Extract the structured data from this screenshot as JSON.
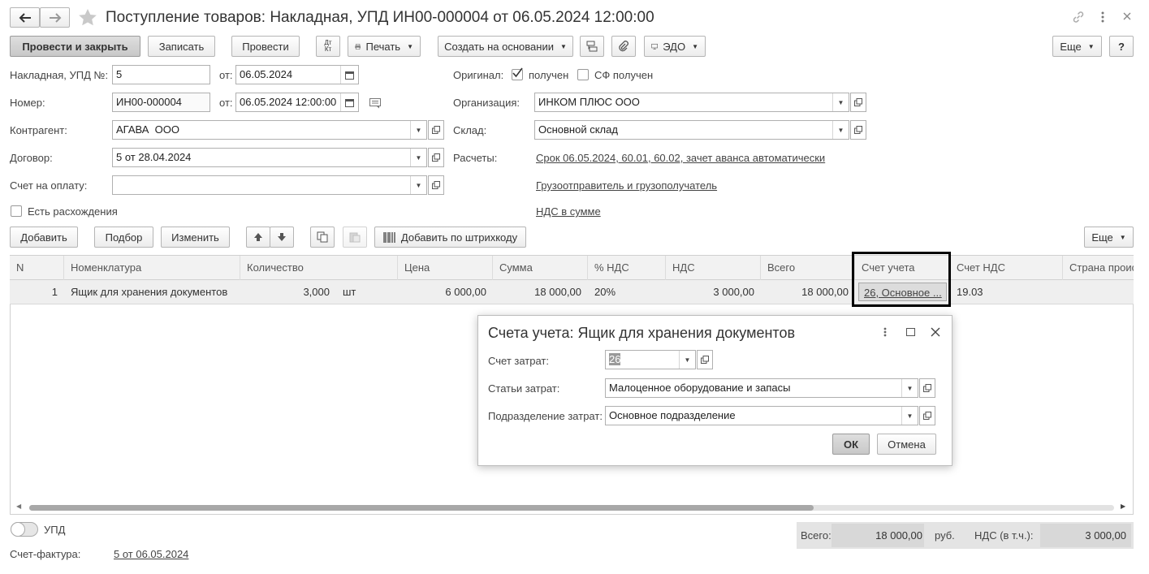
{
  "window": {
    "title": "Поступление товаров: Накладная, УПД ИН00-000004 от 06.05.2024 12:00:00"
  },
  "toolbar": {
    "post_close": "Провести и закрыть",
    "save": "Записать",
    "post": "Провести",
    "dt_kt": "Дт Кт",
    "print": "Печать",
    "create_based": "Создать на основании",
    "edo": "ЭДО",
    "more": "Еще",
    "help": "?"
  },
  "form": {
    "invoice_label": "Накладная, УПД №:",
    "invoice_value": "5",
    "from_label": "от:",
    "invoice_date": "06.05.2024",
    "number_label": "Номер:",
    "number_value": "ИН00-000004",
    "number_date": "06.05.2024 12:00:00",
    "contractor_label": "Контрагент:",
    "contractor_value": "АГАВА  ООО",
    "contract_label": "Договор:",
    "contract_value": "5 от 28.04.2024",
    "payment_label": "Счет на оплату:",
    "payment_value": "",
    "discrepancy_label": "Есть расхождения",
    "original_label": "Оригинал:",
    "received_label": "получен",
    "sf_received_label": "СФ получен",
    "org_label": "Организация:",
    "org_value": "ИНКОМ ПЛЮС ООО",
    "warehouse_label": "Склад:",
    "warehouse_value": "Основной склад",
    "settlements_label": "Расчеты:",
    "settlements_link": "Срок 06.05.2024, 60.01, 60.02, зачет аванса автоматически",
    "shipper_link": "Грузоотправитель и грузополучатель",
    "vat_link": "НДС в сумме"
  },
  "table_toolbar": {
    "add": "Добавить",
    "pick": "Подбор",
    "change": "Изменить",
    "barcode": "Добавить по штрихкоду",
    "more": "Еще"
  },
  "table": {
    "columns": [
      "N",
      "Номенклатура",
      "Количество",
      "Цена",
      "Сумма",
      "% НДС",
      "НДС",
      "Всего",
      "Счет учета",
      "Счет НДС",
      "Страна проис"
    ],
    "rows": [
      {
        "n": "1",
        "item": "Ящик для хранения документов",
        "qty": "3,000",
        "unit": "шт",
        "price": "6 000,00",
        "sum": "18 000,00",
        "vat_rate": "20%",
        "vat": "3 000,00",
        "total": "18 000,00",
        "account": "26, Основное ...",
        "vat_account": "19.03",
        "country": ""
      }
    ]
  },
  "dialog": {
    "title": "Счета учета: Ящик для хранения документов",
    "cost_account_label": "Счет затрат:",
    "cost_account_value": "26",
    "cost_items_label": "Статьи затрат:",
    "cost_items_value": "Малоценное оборудование и запасы",
    "cost_dept_label": "Подразделение затрат:",
    "cost_dept_value": "Основное подразделение",
    "ok": "ОК",
    "cancel": "Отмена"
  },
  "footer": {
    "upd_label": "УПД",
    "invoice_label": "Счет-фактура:",
    "invoice_link": "5 от 06.05.2024",
    "total_label": "Всего:",
    "total_value": "18 000,00",
    "currency": "руб.",
    "vat_label": "НДС (в т.ч.):",
    "vat_value": "3 000,00"
  }
}
